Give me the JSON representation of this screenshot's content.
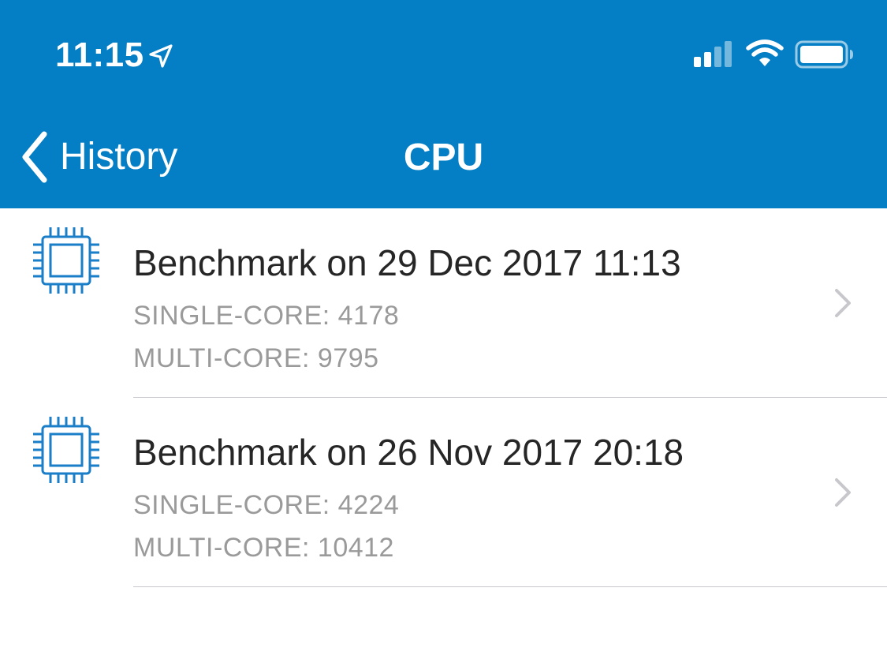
{
  "status_bar": {
    "time": "11:15",
    "icons": [
      "location-arrow-icon",
      "cellular-signal-icon",
      "wifi-icon",
      "battery-icon"
    ]
  },
  "nav": {
    "back_label": "History",
    "title": "CPU",
    "back_icon": "chevron-left-icon"
  },
  "colors": {
    "header_bg": "#047ec4",
    "accent_icon": "#1a7ec8",
    "title_text": "#262626",
    "secondary_text": "#9a9a9a",
    "separator": "#c8c7cc",
    "chevron": "#c7c7cc"
  },
  "benchmarks": [
    {
      "icon": "cpu-chip-icon",
      "title": "Benchmark on 29 Dec 2017 11:13",
      "single_core": "SINGLE-CORE: 4178",
      "multi_core": "MULTI-CORE: 9795"
    },
    {
      "icon": "cpu-chip-icon",
      "title": "Benchmark on 26 Nov 2017 20:18",
      "single_core": "SINGLE-CORE: 4224",
      "multi_core": "MULTI-CORE: 10412"
    }
  ]
}
